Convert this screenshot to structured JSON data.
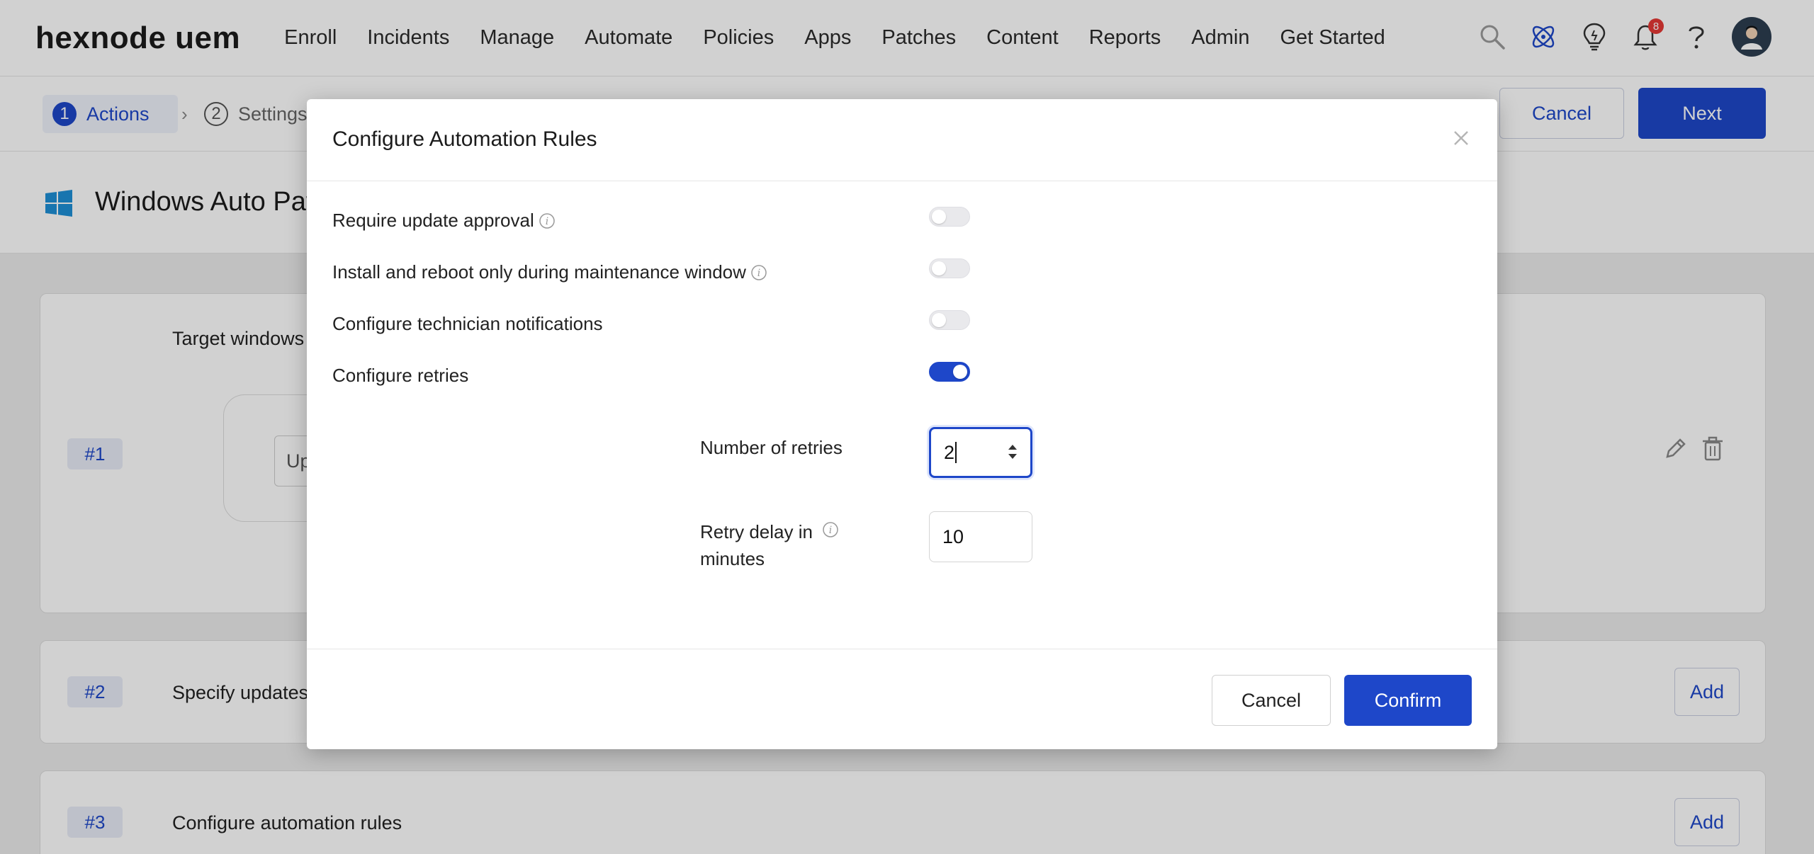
{
  "brand": {
    "logo_text": "hexnode uem"
  },
  "nav": {
    "items": [
      "Enroll",
      "Incidents",
      "Manage",
      "Automate",
      "Policies",
      "Apps",
      "Patches",
      "Content",
      "Reports",
      "Admin",
      "Get Started"
    ],
    "notification_count": "8",
    "icons": [
      "search-icon",
      "atom-icon",
      "lightbulb-icon",
      "bell-icon",
      "help-icon",
      "avatar"
    ]
  },
  "stepper": {
    "steps": [
      {
        "number": "1",
        "label": "Actions"
      },
      {
        "number": "2",
        "label": "Settings"
      }
    ],
    "cancel_label": "Cancel",
    "next_label": "Next"
  },
  "page": {
    "title": "Windows Auto Patc",
    "cards": [
      {
        "tag": "#1",
        "text": "Target windows C",
        "inner_input": "Up"
      },
      {
        "tag": "#2",
        "text": "Specify updates te",
        "add_label": "Add"
      },
      {
        "tag": "#3",
        "text": "Configure automation rules",
        "add_label": "Add"
      }
    ]
  },
  "modal": {
    "title": "Configure Automation Rules",
    "options": [
      {
        "label": "Require update approval",
        "enabled": false,
        "info": true
      },
      {
        "label": "Install and reboot only during maintenance window",
        "enabled": false,
        "info": true
      },
      {
        "label": "Configure technician notifications",
        "enabled": false,
        "info": false
      },
      {
        "label": "Configure retries",
        "enabled": true,
        "info": false
      }
    ],
    "retries": {
      "label": "Number of retries",
      "value": "2",
      "delay_label_line1": "Retry delay in",
      "delay_label_line2": "minutes",
      "delay_value": "10"
    },
    "cancel_label": "Cancel",
    "confirm_label": "Confirm"
  },
  "colors": {
    "accent": "#1e47c9",
    "toggle_off": "#e9e9ec",
    "badge": "#e53935"
  }
}
